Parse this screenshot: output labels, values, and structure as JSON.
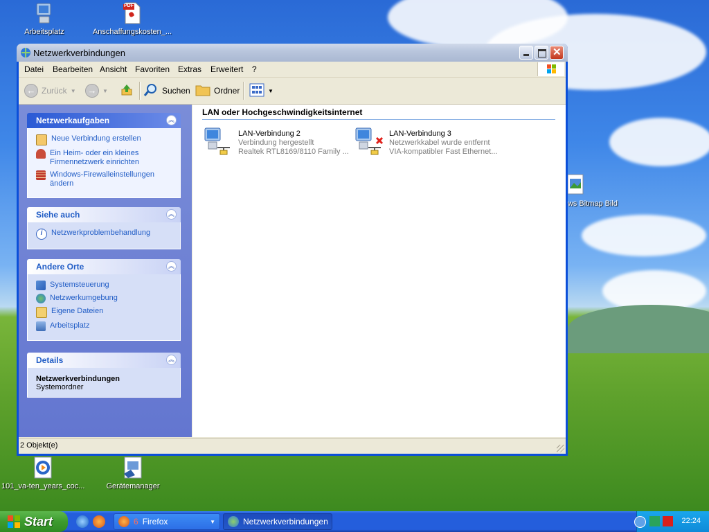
{
  "desktop": {
    "icons_top": [
      {
        "label": "Arbeitsplatz",
        "icon": "my-computer-icon"
      },
      {
        "label": "Anschaffungskosten_...",
        "icon": "pdf-file-icon",
        "badge": "PDF"
      }
    ],
    "icons_right": [
      {
        "label": "ows Bitmap Bild",
        "icon": "bitmap-image-icon"
      }
    ],
    "icons_bottom": [
      {
        "label": "101_va-ten_years_coc...",
        "icon": "media-file-icon"
      },
      {
        "label": "Gerätemanager",
        "icon": "device-manager-icon"
      }
    ]
  },
  "window": {
    "title": "Netzwerkverbindungen",
    "menu": [
      "Datei",
      "Bearbeiten",
      "Ansicht",
      "Favoriten",
      "Extras",
      "Erweitert",
      "?"
    ],
    "toolbar": {
      "back": "Zurück",
      "search": "Suchen",
      "folders": "Ordner"
    },
    "taskpane": {
      "network_tasks": {
        "title": "Netzwerkaufgaben",
        "items": [
          {
            "label": "Neue Verbindung erstellen",
            "icon": "new-connection-icon"
          },
          {
            "label": "Ein Heim- oder ein kleines Firmennetzwerk einrichten",
            "icon": "home-network-icon"
          },
          {
            "label": "Windows-Firewalleinstellungen ändern",
            "icon": "firewall-icon"
          }
        ]
      },
      "see_also": {
        "title": "Siehe auch",
        "items": [
          {
            "label": "Netzwerkproblembehandlung",
            "icon": "info-icon"
          }
        ]
      },
      "other_places": {
        "title": "Andere Orte",
        "items": [
          {
            "label": "Systemsteuerung",
            "icon": "control-panel-icon"
          },
          {
            "label": "Netzwerkumgebung",
            "icon": "network-places-icon"
          },
          {
            "label": "Eigene Dateien",
            "icon": "my-documents-icon"
          },
          {
            "label": "Arbeitsplatz",
            "icon": "my-computer-icon"
          }
        ]
      },
      "details": {
        "title": "Details",
        "name": "Netzwerkverbindungen",
        "type": "Systemordner"
      }
    },
    "content": {
      "group_title": "LAN oder Hochgeschwindigkeitsinternet",
      "connections": [
        {
          "name": "LAN-Verbindung 2",
          "status": "Verbindung hergestellt",
          "device": "Realtek RTL8169/8110 Family ...",
          "state": "connected"
        },
        {
          "name": "LAN-Verbindung 3",
          "status": "Netzwerkkabel wurde entfernt",
          "device": "VIA-kompatibler Fast Ethernet...",
          "state": "disconnected"
        }
      ]
    },
    "statusbar": "2 Objekt(e)"
  },
  "taskbar": {
    "start": "Start",
    "tasks": [
      {
        "count": "6",
        "label": "Firefox",
        "state": "inactive"
      },
      {
        "label": "Netzwerkverbindungen",
        "state": "active"
      }
    ],
    "clock": "22:24"
  },
  "colors": {
    "taskpane_bg": "#6376d0",
    "link": "#215dc6",
    "taskbar": "#245edc",
    "start": "#3d9b2e"
  }
}
